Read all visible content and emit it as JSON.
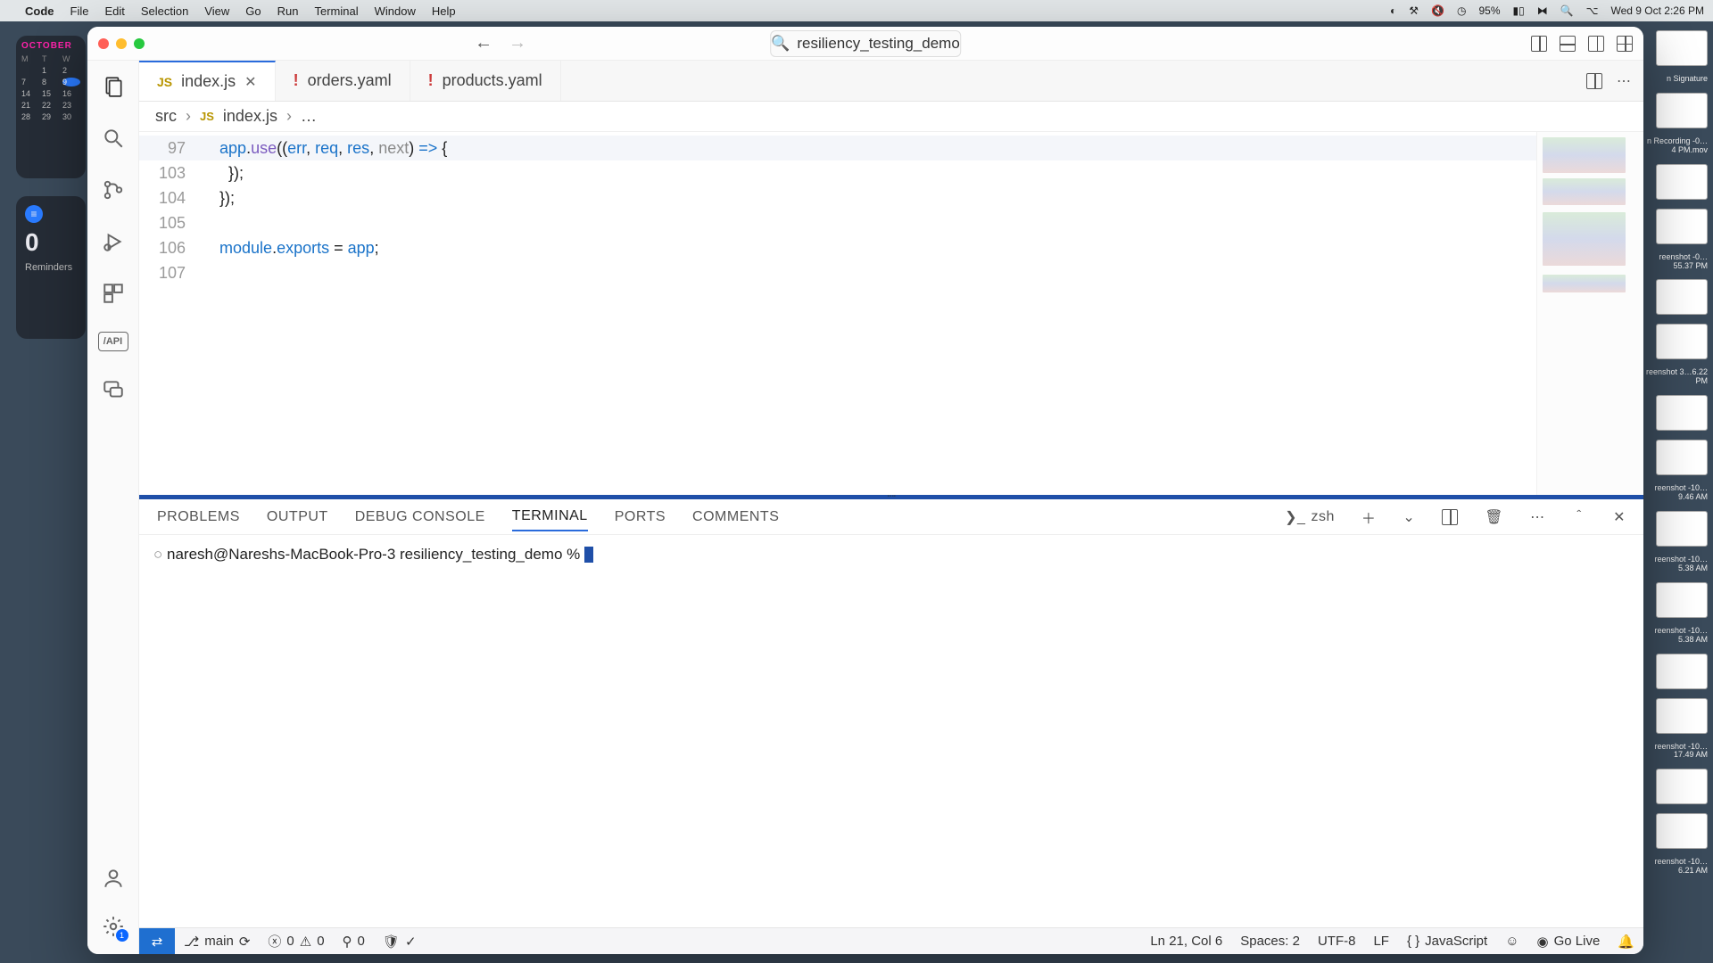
{
  "mac_menu": {
    "app": "Code",
    "items": [
      "File",
      "Edit",
      "Selection",
      "View",
      "Go",
      "Run",
      "Terminal",
      "Window",
      "Help"
    ],
    "battery_pct": "95%",
    "datetime": "Wed 9 Oct  2:26 PM"
  },
  "desktop": {
    "calendar_month": "OCTOBER",
    "calendar_dow": [
      "M",
      "T",
      "W"
    ],
    "calendar_days": [
      "",
      "1",
      "2",
      "7",
      "8",
      "9",
      "14",
      "15",
      "16",
      "21",
      "22",
      "23",
      "28",
      "29",
      "30"
    ],
    "reminders_count": "0",
    "reminders_label": "Reminders",
    "right_items": [
      {
        "cap": "n Signature"
      },
      {
        "cap": "n Recording\n-0…4 PM.mov"
      },
      {
        "cap": ""
      },
      {
        "cap": "reenshot\n-0…55.37 PM"
      },
      {
        "cap": ""
      },
      {
        "cap": "reenshot\n3…6.22 PM"
      },
      {
        "cap": ""
      },
      {
        "cap": "reenshot\n-10…9.46 AM"
      },
      {
        "cap": "reenshot\n-10…5.38 AM"
      },
      {
        "cap": "reenshot\n-10…5.38 AM"
      },
      {
        "cap": ""
      },
      {
        "cap": "reenshot\n-10…17.49 AM"
      },
      {
        "cap": ""
      },
      {
        "cap": "reenshot\n-10…6.21 AM"
      }
    ]
  },
  "vscode": {
    "search_text": "resiliency_testing_demo",
    "tabs": [
      {
        "icon": "JS",
        "label": "index.js",
        "active": true,
        "dirty": false
      },
      {
        "icon": "!",
        "label": "orders.yaml",
        "active": false
      },
      {
        "icon": "!",
        "label": "products.yaml",
        "active": false
      }
    ],
    "breadcrumb": {
      "folder": "src",
      "file": "index.js",
      "trail": "…"
    },
    "code_lines": [
      {
        "n": "97",
        "hl": true,
        "tokens": [
          [
            "plain",
            "    "
          ],
          [
            "obj",
            "app"
          ],
          [
            "plain",
            "."
          ],
          [
            "fn",
            "use"
          ],
          [
            "plain",
            "(("
          ],
          [
            "param",
            "err"
          ],
          [
            "plain",
            ", "
          ],
          [
            "param",
            "req"
          ],
          [
            "plain",
            ", "
          ],
          [
            "param",
            "res"
          ],
          [
            "plain",
            ", "
          ],
          [
            "param-unused",
            "next"
          ],
          [
            "plain",
            ") "
          ],
          [
            "kw",
            "=>"
          ],
          [
            "plain",
            " {"
          ]
        ]
      },
      {
        "n": "103",
        "tokens": [
          [
            "plain",
            "      });"
          ]
        ]
      },
      {
        "n": "104",
        "tokens": [
          [
            "plain",
            "    });"
          ]
        ]
      },
      {
        "n": "105",
        "tokens": [
          [
            "plain",
            ""
          ]
        ]
      },
      {
        "n": "106",
        "tokens": [
          [
            "plain",
            "    "
          ],
          [
            "obj",
            "module"
          ],
          [
            "plain",
            "."
          ],
          [
            "prop",
            "exports"
          ],
          [
            "plain",
            " = "
          ],
          [
            "obj",
            "app"
          ],
          [
            "plain",
            ";"
          ]
        ]
      },
      {
        "n": "107",
        "tokens": [
          [
            "plain",
            ""
          ]
        ]
      }
    ],
    "panel_tabs": [
      "PROBLEMS",
      "OUTPUT",
      "DEBUG CONSOLE",
      "TERMINAL",
      "PORTS",
      "COMMENTS"
    ],
    "panel_active": "TERMINAL",
    "terminal_shell": "zsh",
    "terminal_prompt": "naresh@Nareshs-MacBook-Pro-3 resiliency_testing_demo % ",
    "status": {
      "branch": "main",
      "errors": "0",
      "warnings": "0",
      "ports": "0",
      "cursor": "Ln 21, Col 6",
      "spaces": "Spaces: 2",
      "encoding": "UTF-8",
      "eol": "LF",
      "language": "JavaScript",
      "golive": "Go Live"
    },
    "settings_badge": "1"
  }
}
